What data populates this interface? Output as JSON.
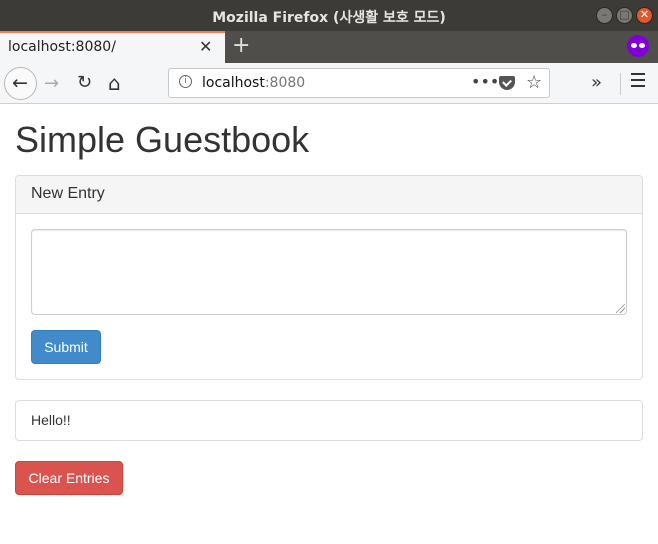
{
  "window": {
    "title": "Mozilla Firefox (사생활 보호 모드)"
  },
  "tabs": [
    {
      "label": "localhost:8080/",
      "active": true
    }
  ],
  "urlbar": {
    "host": "localhost",
    "port": ":8080"
  },
  "icons": {
    "minimize": "minimize-icon",
    "maximize": "maximize-icon",
    "close": "close-icon",
    "tab_close": "close-icon",
    "new_tab": "plus-icon",
    "private": "private-browsing-mask-icon",
    "back": "back-arrow-icon",
    "forward": "forward-arrow-icon",
    "reload": "reload-icon",
    "home": "home-icon",
    "info": "info-icon",
    "page_actions": "ellipsis-icon",
    "pocket": "pocket-icon",
    "bookmark": "star-icon",
    "overflow": "double-chevron-icon",
    "menu": "hamburger-menu-icon"
  },
  "glyphs": {
    "close": "✕",
    "new_tab": "+",
    "back": "←",
    "forward": "→",
    "reload": "↻",
    "home": "⌂",
    "info": "i",
    "dots": "•••",
    "star": "☆",
    "overflow": "»"
  },
  "page": {
    "title": "Simple Guestbook",
    "form": {
      "heading": "New Entry",
      "textarea_value": "",
      "submit_label": "Submit"
    },
    "entries": [
      "Hello!!"
    ],
    "clear_label": "Clear Entries"
  },
  "colors": {
    "primary": "#428bca",
    "danger": "#d9534f",
    "private_accent": "#8000d7",
    "tab_accent": "#ef7d52"
  }
}
